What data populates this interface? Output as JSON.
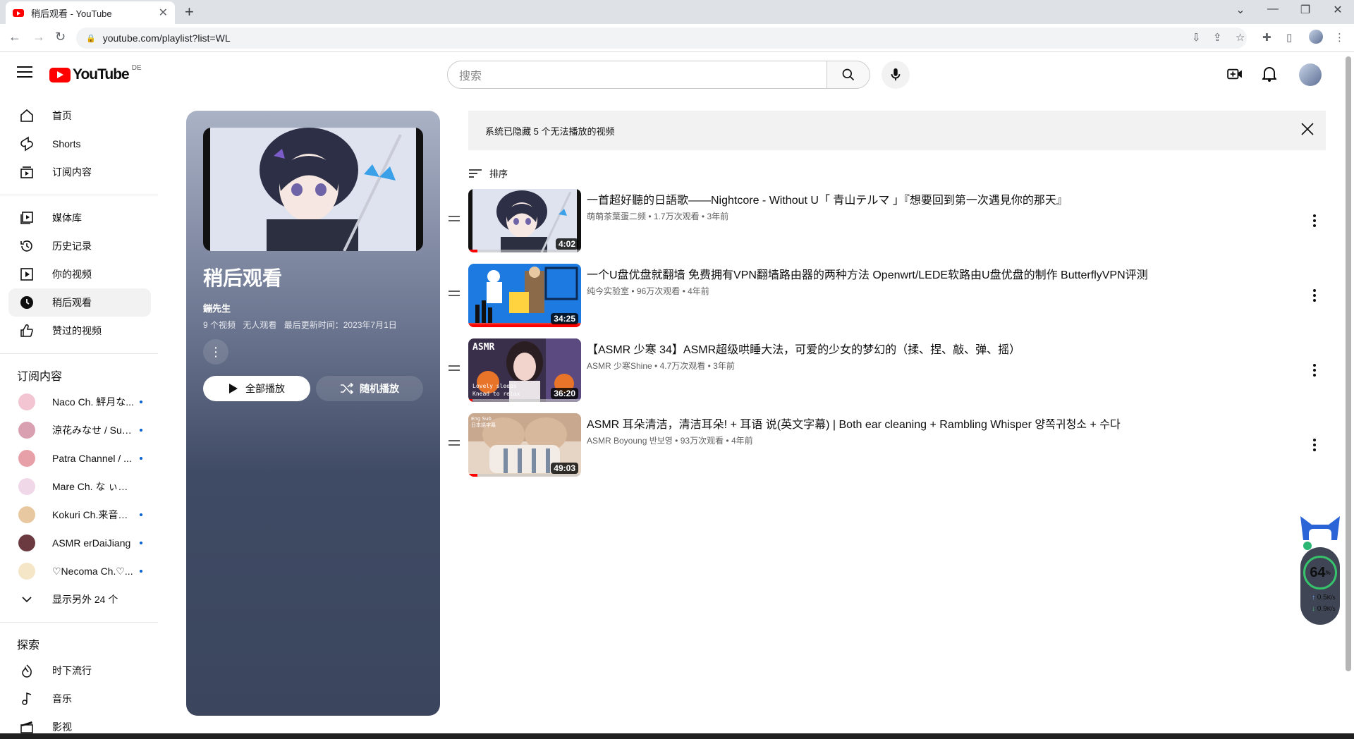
{
  "browser": {
    "tab_title": "稍后观看 - YouTube",
    "tab_close": "✕",
    "new_tab": "+",
    "url": "youtube.com/playlist?list=WL",
    "window_controls": [
      "⌄",
      "—",
      "❐",
      "✕"
    ]
  },
  "masthead": {
    "logo_text": "YouTube",
    "country_code": "DE",
    "search_placeholder": "搜索"
  },
  "sidebar": {
    "main": [
      {
        "label": "首页",
        "icon": "home-icon"
      },
      {
        "label": "Shorts",
        "icon": "shorts-icon"
      },
      {
        "label": "订阅内容",
        "icon": "subscriptions-icon"
      }
    ],
    "library": [
      {
        "label": "媒体库",
        "icon": "library-icon"
      },
      {
        "label": "历史记录",
        "icon": "history-icon"
      },
      {
        "label": "你的视频",
        "icon": "your-videos-icon"
      },
      {
        "label": "稍后观看",
        "icon": "watch-later-icon",
        "active": true
      },
      {
        "label": "赞过的视频",
        "icon": "liked-icon"
      }
    ],
    "subscriptions_heading": "订阅内容",
    "subscriptions": [
      {
        "name": "Naco Ch. 鮃月な...",
        "color": "#f3c5d3",
        "live": true
      },
      {
        "name": "涼花みなせ / Suz...",
        "color": "#d8a0b0",
        "live": true
      },
      {
        "name": "Patra Channel / ...",
        "color": "#e8a0a8",
        "live": true
      },
      {
        "name": "Mare Ch. な ぃとめ...",
        "color": "#f0d8e8",
        "live": false
      },
      {
        "name": "Kokuri Ch.来音こ...",
        "color": "#e8c8a0",
        "live": true
      },
      {
        "name": "ASMR erDaiJiang",
        "color": "#6a3a40",
        "live": true
      },
      {
        "name": "♡Necoma Ch.♡...",
        "color": "#f5e6c8",
        "live": true
      }
    ],
    "show_more": "显示另外 24 个",
    "explore_heading": "探索",
    "explore": [
      {
        "label": "时下流行",
        "icon": "trending-icon"
      },
      {
        "label": "音乐",
        "icon": "music-icon"
      },
      {
        "label": "影视",
        "icon": "movies-icon"
      }
    ]
  },
  "playlist": {
    "title": "稍后观看",
    "owner": "鏰先生",
    "video_count": "9 个视频",
    "views": "无人观看",
    "updated": "最后更新时间：2023年7月1日",
    "play_all": "全部播放",
    "shuffle": "随机播放",
    "more": "⋮"
  },
  "notice": {
    "text": "系统已隐藏 5 个无法播放的视频"
  },
  "sort_label": "排序",
  "videos": [
    {
      "title": "一首超好聽的日語歌——Nightcore - Without U「 青山テルマ 」『想要回到第一次遇見你的那天』",
      "channel": "萌萌茶葉蛋二频",
      "views": "1.7万次观看",
      "age": "3年前",
      "duration": "4:02",
      "progress": 0.08
    },
    {
      "title": "一个U盘优盘就翻墙 免费拥有VPN翻墙路由器的两种方法 Openwrt/LEDE软路由U盘优盘的制作 ButterflyVPN评测",
      "channel": "纯今实验室",
      "views": "96万次观看",
      "age": "4年前",
      "duration": "34:25",
      "progress": 1.0
    },
    {
      "title": "【ASMR 少寒 34】ASMR超级哄睡大法，可爱的少女的梦幻的（揉、捏、敲、弹、摇）",
      "channel": "ASMR 少寒Shine",
      "views": "4.7万次观看",
      "age": "3年前",
      "duration": "36:20",
      "progress": 0.04,
      "thumb_text_top": "ASMR",
      "thumb_text_bottom": "Lovely sleeps\nKnead to relax"
    },
    {
      "title": "ASMR 耳朵清洁，清洁耳朵! + 耳语 说(英文字幕) | Both ear cleaning + Rambling Whisper 양쪽귀청소 + 수다",
      "channel": "ASMR Boyoung 반보영",
      "views": "93万次观看",
      "age": "4年前",
      "duration": "49:03",
      "progress": 0.08,
      "thumb_text_top": "Eng Sub\n日本語字幕"
    }
  ],
  "net_widget": {
    "percent": "64",
    "percent_unit": "%",
    "upload": "0.5",
    "download": "0.9",
    "speed_unit": "K/s"
  },
  "colors": {
    "brand_red": "#ff0000",
    "live_dot": "#065fd4",
    "card_dark": "#3b465e"
  }
}
